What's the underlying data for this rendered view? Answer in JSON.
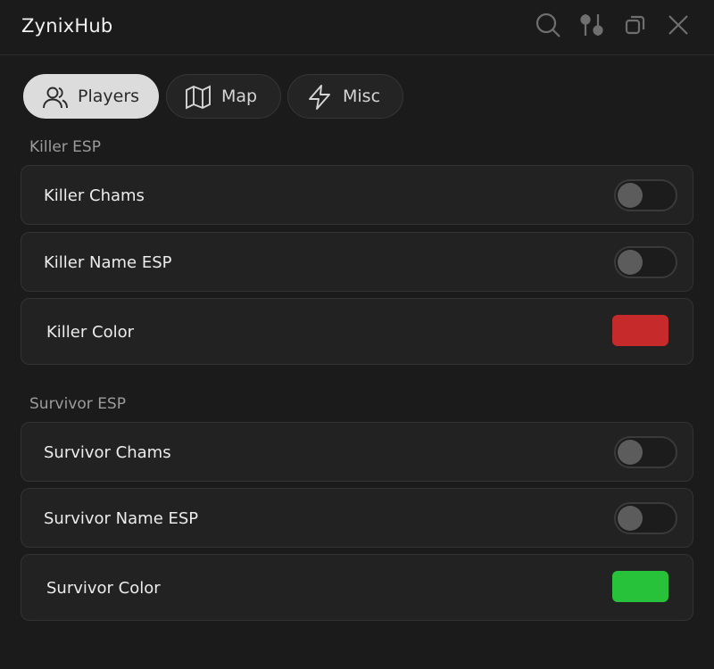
{
  "app": {
    "title": "ZynixHub"
  },
  "titlebar": {
    "icons": [
      "search-icon",
      "sliders-icon",
      "restore-window-icon",
      "close-icon"
    ]
  },
  "tabs": [
    {
      "label": "Players",
      "icon": "users-icon",
      "active": true
    },
    {
      "label": "Map",
      "icon": "map-icon",
      "active": false
    },
    {
      "label": "Misc",
      "icon": "lightning-icon",
      "active": false
    }
  ],
  "sections": {
    "killer": {
      "title": "Killer ESP",
      "chams": {
        "label": "Killer Chams",
        "enabled": false
      },
      "name_esp": {
        "label": "Killer Name ESP",
        "enabled": false
      },
      "color": {
        "label": "Killer Color",
        "value": "#c62a2a"
      }
    },
    "survivor": {
      "title": "Survivor ESP",
      "chams": {
        "label": "Survivor Chams",
        "enabled": false
      },
      "name_esp": {
        "label": "Survivor Name ESP",
        "enabled": false
      },
      "color": {
        "label": "Survivor Color",
        "value": "#27c13a"
      }
    }
  }
}
